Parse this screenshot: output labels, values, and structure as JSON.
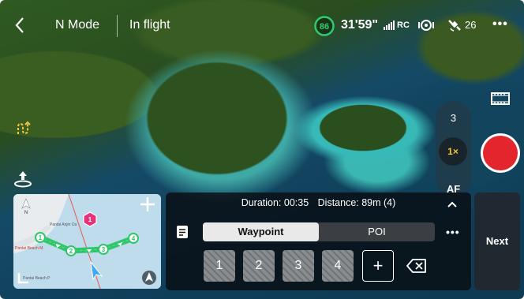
{
  "topbar": {
    "mode": "N Mode",
    "status": "In flight",
    "battery_percent": "86",
    "flight_time": "31'59\"",
    "rc_label": "RC",
    "satellites": "26"
  },
  "camera": {
    "zoom_3": "3",
    "zoom_1": "1×",
    "af": "AF"
  },
  "map": {
    "label_1": "Pantai Anjin Ou",
    "label_2": "Pantai Beach M.",
    "label_3": "Pantai Beach P",
    "poi_marker": "1",
    "waypoints": [
      "1",
      "2",
      "3",
      "4"
    ],
    "route_color": "#2fc76a"
  },
  "panel": {
    "duration": "Duration: 00:35",
    "distance": "Distance: 89m (4)",
    "tab_waypoint": "Waypoint",
    "tab_poi": "POI",
    "waypoints": [
      "1",
      "2",
      "3",
      "4"
    ],
    "add": "+",
    "next": "Next"
  },
  "colors": {
    "battery_ring": "#2ecc71",
    "zoom_active": "#f3c63b",
    "record": "#e3262d",
    "poi_marker": "#e8317a"
  }
}
